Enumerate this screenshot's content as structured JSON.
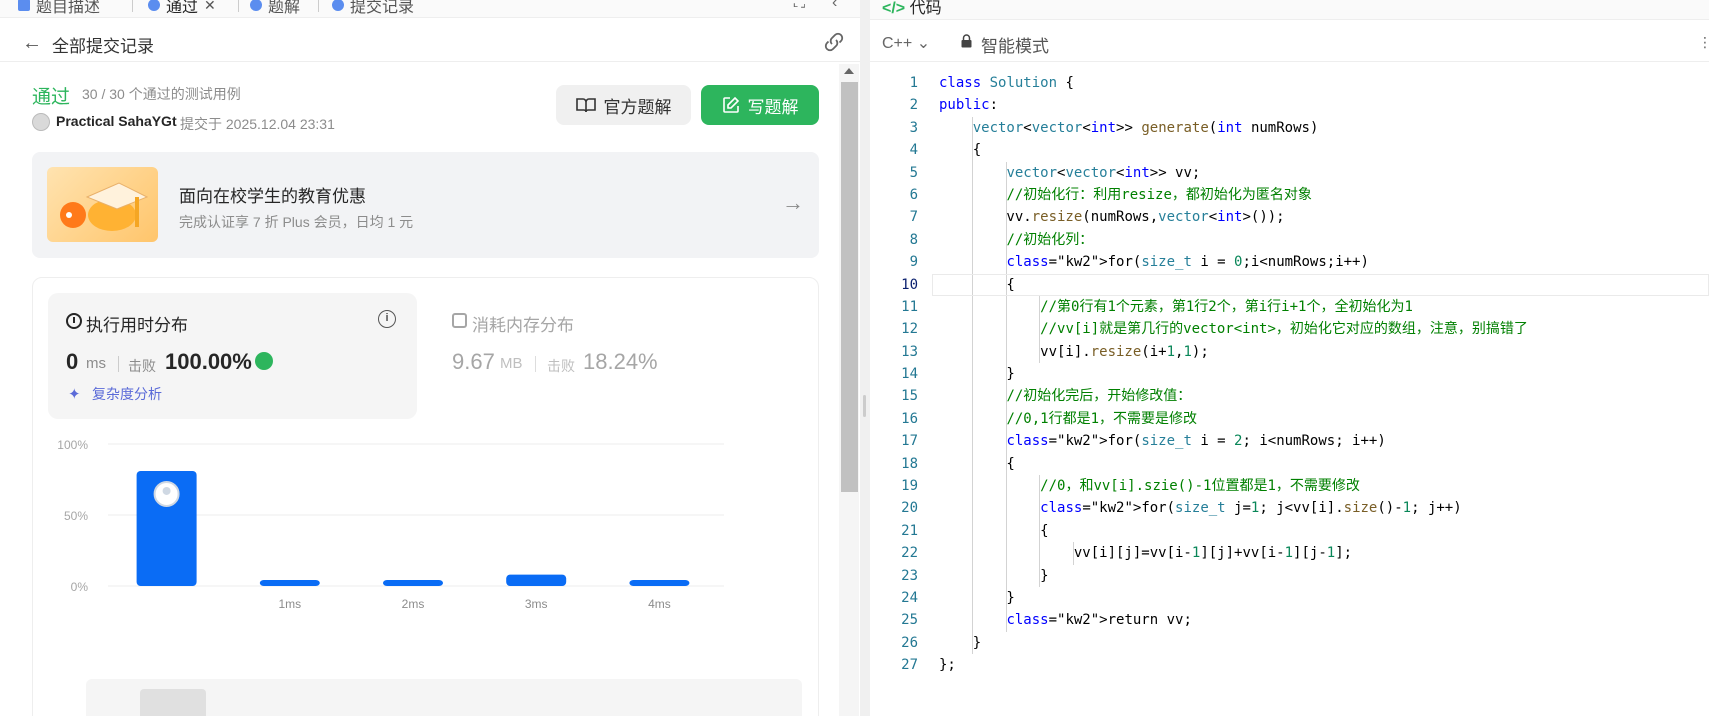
{
  "left_tabs": [
    {
      "label": "题目描述",
      "active": false
    },
    {
      "label": "通过",
      "active": true
    },
    {
      "label": "题解",
      "active": false
    },
    {
      "label": "提交记录",
      "active": false
    }
  ],
  "subheader": {
    "title": "全部提交记录"
  },
  "submission": {
    "status": "通过",
    "cases": "30 / 30 个通过的测试用例",
    "author": "Practical SahaYGt",
    "submitted_at": "提交于 2025.12.04 23:31"
  },
  "buttons": {
    "official": "官方题解",
    "write": "写题解"
  },
  "promo": {
    "title": "面向在校学生的教育优惠",
    "subtitle": "完成认证享 7 折 Plus 会员，日均 1 元"
  },
  "runtime": {
    "title": "执行用时分布",
    "value": "0",
    "unit": "ms",
    "beat_label": "击败",
    "beat": "100.00%",
    "complexity": "复杂度分析"
  },
  "memory": {
    "title": "消耗内存分布",
    "value": "9.67",
    "unit": "MB",
    "beat_label": "击败",
    "beat": "18.24%"
  },
  "chart_data": {
    "type": "bar",
    "categories": [
      "",
      "1ms",
      "2ms",
      "3ms",
      "4ms"
    ],
    "values": [
      81,
      3,
      3,
      8,
      3
    ],
    "y_ticks": [
      "100%",
      "50%",
      "0%"
    ],
    "ylim": [
      0,
      100
    ],
    "highlight_index": 0,
    "bar_color": "#0a6cf5",
    "grid": true
  },
  "code_panel": {
    "tab": "代码",
    "language": "C++",
    "mode": "智能模式",
    "current_line": 10
  },
  "code_lines": [
    "class Solution {",
    "public:",
    "    vector<vector<int>> generate(int numRows)",
    "    {",
    "        vector<vector<int>> vv;",
    "        //初始化行：利用resize，都初始化为匿名对象",
    "        vv.resize(numRows,vector<int>());",
    "        //初始化列：",
    "        for(size_t i = 0;i<numRows;i++)",
    "        {",
    "            //第0行有1个元素，第1行2个，第i行i+1个，全初始化为1",
    "            //vv[i]就是第几行的vector<int>，初始化它对应的数组，注意，别搞错了",
    "            vv[i].resize(i+1,1);",
    "        }",
    "        //初始化完后，开始修改值：",
    "        //0,1行都是1，不需要是修改",
    "        for(size_t i = 2; i<numRows; i++)",
    "        {",
    "            //0，和vv[i].szie()-1位置都是1，不需要修改",
    "            for(size_t j=1; j<vv[i].size()-1; j++)",
    "            {",
    "                vv[i][j]=vv[i-1][j]+vv[i-1][j-1];",
    "            }",
    "        }",
    "        return vv;",
    "    }",
    "};"
  ]
}
